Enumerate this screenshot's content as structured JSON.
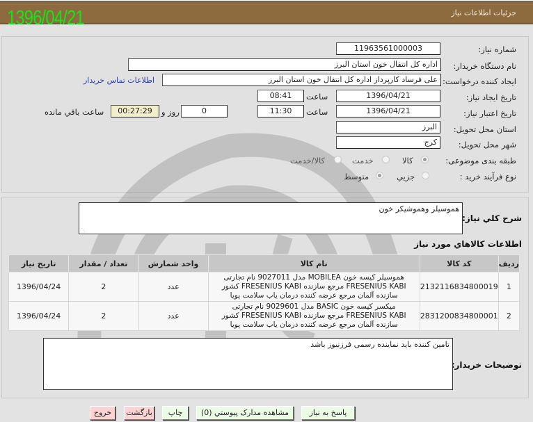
{
  "header": {
    "title": "جزئيات اطلاعات نياز",
    "stamp_date": "1396/04/21"
  },
  "form": {
    "need_number": {
      "label": "شماره نياز:",
      "value": "11963561000003"
    },
    "buyer_org": {
      "label": "نام دستگاه خريدار:",
      "value": "اداره کل انتقال خون استان البرز"
    },
    "requester": {
      "label": "ايجاد کننده درخواست:",
      "value": "علی  فرساد کارپرداز اداره کل انتقال خون استان البرز",
      "contact_link": "اطلاعات تماس خريدار"
    },
    "created": {
      "label": "تاريخ ايجاد نياز:",
      "date": "1396/04/21",
      "time_label": "ساعت",
      "time": "08:41"
    },
    "validity": {
      "label": "تاريخ اعتبار نياز:",
      "date": "1396/04/21",
      "time_label": "ساعت",
      "time": "11:30",
      "days": "0",
      "days_label": "روز و",
      "remaining": "00:27:29",
      "remaining_label": "ساعت باقي مانده"
    },
    "province": {
      "label": "استان محل تحويل:",
      "value": "البرز"
    },
    "city": {
      "label": "شهر محل تحويل:",
      "value": "کرج"
    },
    "category": {
      "label": "طبقه بندی موضوعی:",
      "options": [
        {
          "label": "کالا",
          "checked": true
        },
        {
          "label": "خدمت",
          "checked": false
        },
        {
          "label": "کالا/خدمت",
          "checked": false
        }
      ]
    },
    "process": {
      "label": "نوع فرآيند خريد :",
      "options": [
        {
          "label": "جزيي",
          "checked": false
        },
        {
          "label": "متوسط",
          "checked": true
        }
      ]
    }
  },
  "description": {
    "label": "شرح کلي نياز:",
    "value": "هموسيلر وهموشيکر خون"
  },
  "items_section": {
    "title": "اطلاعات کالاهاي مورد نياز",
    "columns": [
      "رديف",
      "کد کالا",
      "نام کالا",
      "واحد شمارش",
      "تعداد / مقدار",
      "تاريخ نياز"
    ],
    "rows": [
      {
        "row": "1",
        "code": "2132116834800019",
        "name_lines": [
          "هموسيلر کيسه خون MOBILEA مدل 9027011 نام تجارتی",
          "FRESENIUS KABI مرجع سازنده FRESENIUS KABI کشور",
          "سازنده آلمان مرجع عرضه کننده درمان ياب سلامت پويا"
        ],
        "unit": "عدد",
        "qty": "2",
        "date": "1396/04/24"
      },
      {
        "row": "2",
        "code": "2831200834800001",
        "name_lines": [
          "ميکسر کيسه خون BASIC مدل 9029601 نام تجارتی",
          "FRESENIUS KABI مرجع سازنده FRESENIUS KABI کشور",
          "سازنده آلمان مرجع عرضه کننده درمان ياب سلامت پويا"
        ],
        "unit": "عدد",
        "qty": "2",
        "date": "1396/04/24"
      }
    ]
  },
  "buyer_notes": {
    "label": "توضيحات خريدار:",
    "value": "تامين کننده بايد نماينده رسمی فرزنيوز باشد"
  },
  "buttons": {
    "reply": "پاسخ به نياز",
    "attachments": "مشاهده مدارک پيوستي (0)",
    "print": "چاپ",
    "back": "بازگشت",
    "exit": "خروج"
  },
  "colors": {
    "title_bar": "#8e6a3f",
    "stamp": "#13e51a",
    "link": "#2d3ba5",
    "button_green": "#ebfbe4",
    "button_red": "#fbd3d3",
    "remaining_bg": "#f1eecb"
  }
}
